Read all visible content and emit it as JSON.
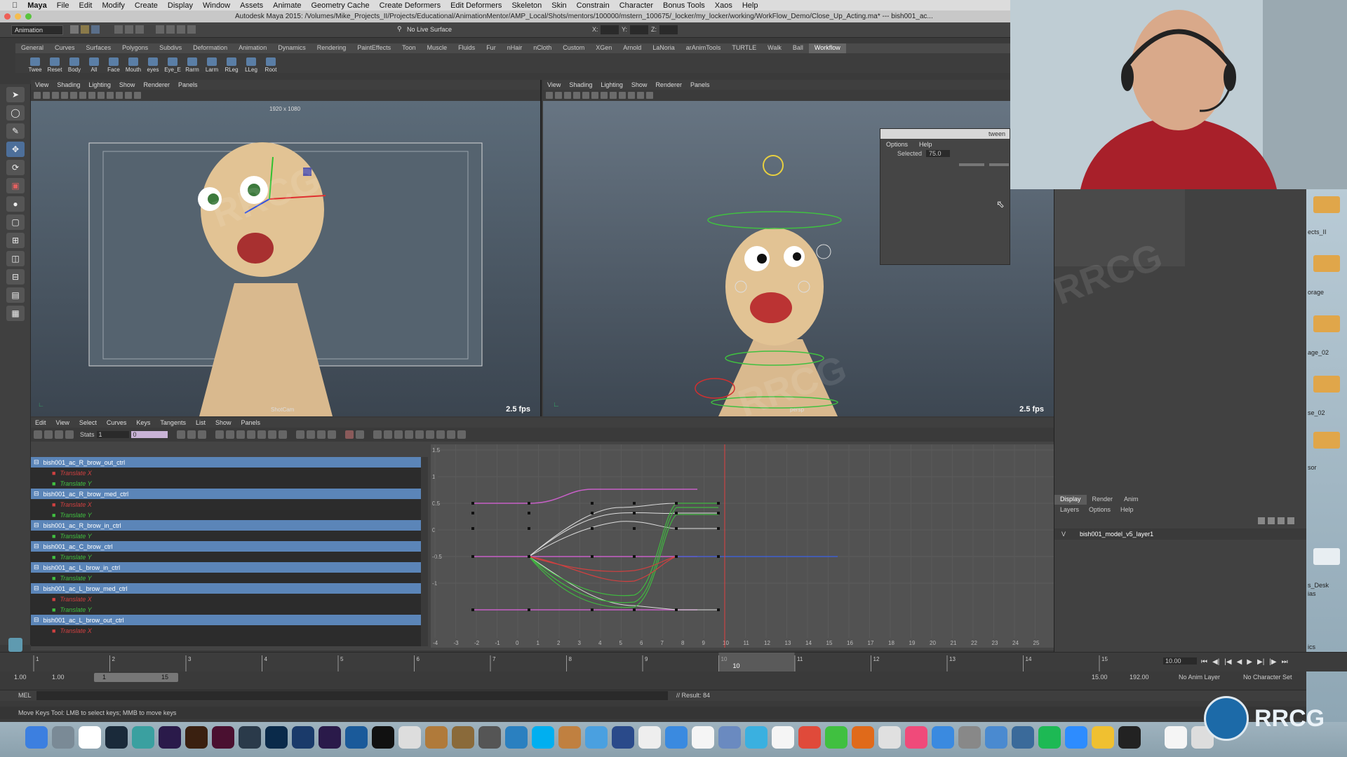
{
  "menubar": {
    "app": "Maya",
    "items": [
      "File",
      "Edit",
      "Modify",
      "Create",
      "Display",
      "Window",
      "Assets",
      "Animate",
      "Geometry Cache",
      "Create Deformers",
      "Edit Deformers",
      "Skeleton",
      "Skin",
      "Constrain",
      "Character",
      "Bonus Tools",
      "Xaos",
      "Help"
    ]
  },
  "titlebar": {
    "title": "Autodesk Maya 2015: /Volumes/Mike_Projects_II/Projects/Educational/AnimationMentor/AMP_Local/Shots/mentors/100000/mstern_100675/_locker/my_locker/working/WorkFlow_Demo/Close_Up_Acting.ma*  ---  bish001_ac..."
  },
  "statusline": {
    "menuset": "Animation",
    "live_surface": "No Live Surface",
    "x_label": "X:",
    "y_label": "Y:",
    "z_label": "Z:"
  },
  "shelf": {
    "tabs": [
      "General",
      "Curves",
      "Surfaces",
      "Polygons",
      "Subdivs",
      "Deformation",
      "Animation",
      "Dynamics",
      "Rendering",
      "PaintEffects",
      "Toon",
      "Muscle",
      "Fluids",
      "Fur",
      "nHair",
      "nCloth",
      "Custom",
      "XGen",
      "Arnold",
      "LaNoria",
      "arAnimTools",
      "TURTLE",
      "Walk",
      "Ball",
      "Workflow"
    ],
    "active_tab": "Workflow",
    "buttons": [
      "Twee",
      "Reset",
      "Body",
      "All",
      "Face",
      "Mouth",
      "eyes",
      "Eye_E",
      "Rarm",
      "Larm",
      "RLeg",
      "LLeg",
      "Root"
    ]
  },
  "viewport_left": {
    "menus": [
      "View",
      "Shading",
      "Lighting",
      "Show",
      "Renderer",
      "Panels"
    ],
    "resolution": "1920 x 1080",
    "camera": "ShotCam",
    "fps": "2.5 fps"
  },
  "viewport_right": {
    "menus": [
      "View",
      "Shading",
      "Lighting",
      "Show",
      "Renderer",
      "Panels"
    ],
    "camera": "persp",
    "fps": "2.5 fps"
  },
  "tween_window": {
    "title": "tween",
    "menus": [
      "Options",
      "Help"
    ],
    "selected_label": "Selected",
    "selected_value": "75.0"
  },
  "layer_editor": {
    "tabs": [
      "Display",
      "Render",
      "Anim"
    ],
    "active_tab": "Display",
    "menus": [
      "Layers",
      "Options",
      "Help"
    ],
    "visibility": "V",
    "layer": "bish001_model_v5_layer1"
  },
  "desktop_labels": [
    "ects_II",
    "orage",
    "age_02",
    "se_02",
    "sor",
    "s_Desk",
    "ias",
    "ics"
  ],
  "graph_editor": {
    "menus": [
      "Edit",
      "View",
      "Select",
      "Curves",
      "Keys",
      "Tangents",
      "List",
      "Show",
      "Panels"
    ],
    "stats_label": "Stats",
    "stats_value1": "1",
    "stats_value2": "0",
    "outliner": [
      {
        "type": "obj",
        "name": "bish001_ac_R_brow_out_ctrl"
      },
      {
        "type": "attr",
        "name": "Translate X",
        "axis": "x"
      },
      {
        "type": "attr",
        "name": "Translate Y",
        "axis": "y"
      },
      {
        "type": "obj",
        "name": "bish001_ac_R_brow_med_ctrl"
      },
      {
        "type": "attr",
        "name": "Translate X",
        "axis": "x"
      },
      {
        "type": "attr",
        "name": "Translate Y",
        "axis": "y"
      },
      {
        "type": "obj",
        "name": "bish001_ac_R_brow_in_ctrl"
      },
      {
        "type": "attr",
        "name": "Translate Y",
        "axis": "y"
      },
      {
        "type": "obj",
        "name": "bish001_ac_C_brow_ctrl"
      },
      {
        "type": "attr",
        "name": "Translate Y",
        "axis": "y"
      },
      {
        "type": "obj",
        "name": "bish001_ac_L_brow_in_ctrl"
      },
      {
        "type": "attr",
        "name": "Translate Y",
        "axis": "y"
      },
      {
        "type": "obj",
        "name": "bish001_ac_L_brow_med_ctrl"
      },
      {
        "type": "attr",
        "name": "Translate X",
        "axis": "x"
      },
      {
        "type": "attr",
        "name": "Translate Y",
        "axis": "y"
      },
      {
        "type": "obj",
        "name": "bish001_ac_L_brow_out_ctrl"
      },
      {
        "type": "attr",
        "name": "Translate X",
        "axis": "x"
      }
    ],
    "y_ticks": [
      "1.5",
      "1",
      "0.5",
      "0",
      "-0.5",
      "-1"
    ],
    "x_ticks": [
      "-4",
      "-3",
      "-2",
      "-1",
      "0",
      "1",
      "2",
      "3",
      "4",
      "5",
      "6",
      "7",
      "8",
      "9",
      "10",
      "11",
      "12",
      "13",
      "14",
      "15",
      "16",
      "17",
      "18",
      "19",
      "20",
      "21",
      "22",
      "23",
      "24",
      "25"
    ],
    "current_frame": 10
  },
  "timeline": {
    "ticks": [
      "1",
      "2",
      "3",
      "4",
      "5",
      "6",
      "7",
      "8",
      "9",
      "10",
      "11",
      "12",
      "13",
      "14",
      "15"
    ],
    "current_frame": "10",
    "current_field": "10.00"
  },
  "range": {
    "start": "1.00",
    "start_inner": "1.00",
    "range_start": "1",
    "range_end": "15",
    "end_inner": "15.00",
    "end": "192.00",
    "anim_layer": "No Anim Layer",
    "char_set": "No Character Set"
  },
  "cmdline": {
    "label": "MEL",
    "result": "// Result: 84"
  },
  "helpline": {
    "text": "Move Keys Tool: LMB to select keys; MMB to move keys"
  },
  "watermark": "RRCG",
  "logo_text": "RRCG"
}
